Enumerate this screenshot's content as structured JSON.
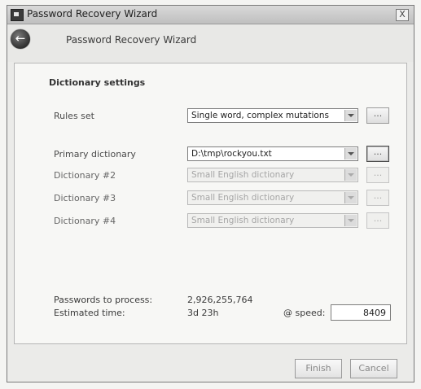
{
  "window": {
    "title": "Password Recovery Wizard",
    "close_label": "X"
  },
  "header": {
    "back_glyph": "←",
    "title": "Password Recovery Wizard"
  },
  "section": {
    "title": "Dictionary settings"
  },
  "rows": [
    {
      "label": "Rules set",
      "value": "Single word, complex mutations",
      "enabled": true,
      "button": "..."
    },
    {
      "label": "Primary dictionary",
      "value": "D:\\tmp\\rockyou.txt",
      "enabled": true,
      "button": "..."
    },
    {
      "label": "Dictionary #2",
      "value": "Small English dictionary",
      "enabled": false,
      "button": "..."
    },
    {
      "label": "Dictionary #3",
      "value": "Small English dictionary",
      "enabled": false,
      "button": "..."
    },
    {
      "label": "Dictionary #4",
      "value": "Small English dictionary",
      "enabled": false,
      "button": "..."
    }
  ],
  "stats": {
    "passwords_label": "Passwords to process:",
    "passwords_value": "2,926,255,764",
    "time_label": "Estimated time:",
    "time_value": "3d 23h",
    "speed_label": "@ speed:",
    "speed_value": "8409"
  },
  "footer": {
    "finish_label": "Finish",
    "cancel_label": "Cancel"
  }
}
